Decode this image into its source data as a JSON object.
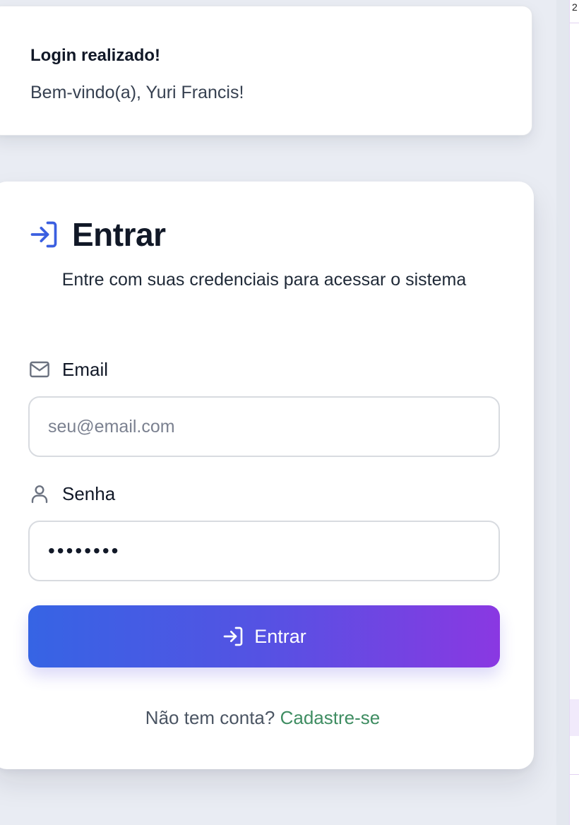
{
  "toast": {
    "title": "Login realizado!",
    "message": "Bem-vindo(a), Yuri Francis!"
  },
  "login": {
    "title": "Entrar",
    "description": "Entre com suas credenciais para acessar o sistema",
    "email_label": "Email",
    "email_placeholder": "seu@email.com",
    "password_label": "Senha",
    "password_value": "••••••••",
    "submit_label": "Entrar",
    "signup_prompt": "Não tem conta? ",
    "signup_link": "Cadastre-se"
  },
  "side_panel": {
    "fragment": "2"
  },
  "colors": {
    "accent_blue": "#3664e4",
    "accent_purple": "#8a38e2",
    "link_green": "#3f8d62"
  },
  "icons": {
    "title_icon": "login-arrow-icon",
    "email_icon": "mail-icon",
    "password_icon": "user-icon",
    "button_icon": "login-arrow-icon"
  }
}
